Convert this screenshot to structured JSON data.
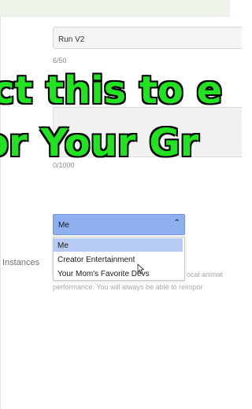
{
  "form": {
    "name_value": "Run V2",
    "name_counter": "6/50",
    "description_counter": "0/1000",
    "creator_selected": "Me",
    "creator_options": [
      "Me",
      "Creator Entertainment",
      "Your Mom's Favorite Devs"
    ],
    "instances_label": "Instances",
    "help_text_line1": "ocal animat",
    "help_text_line2": "performance. You will always be able to reimpor"
  },
  "caption": {
    "line1": "ct this to e",
    "line2": "or Your Gr"
  },
  "colors": {
    "select_bg": "#8fb0ee",
    "option_selected_bg": "#b5cbf3",
    "caption_fill": "#22e322",
    "caption_outline": "#000000"
  }
}
